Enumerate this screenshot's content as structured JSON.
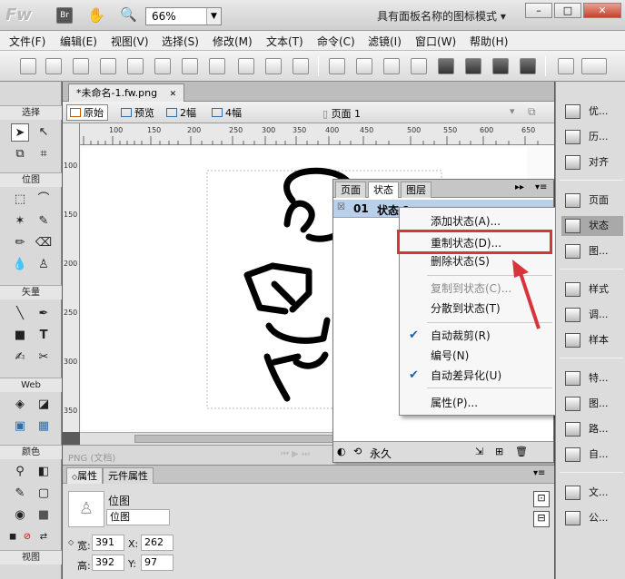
{
  "app": {
    "logo": "Fw",
    "zoom": "66%",
    "workspace_mode": "具有面板名称的图标模式",
    "window_buttons": [
      "–",
      "□",
      "✕"
    ]
  },
  "menu": [
    "文件(F)",
    "编辑(E)",
    "视图(V)",
    "选择(S)",
    "修改(M)",
    "文本(T)",
    "命令(C)",
    "滤镜(I)",
    "窗口(W)",
    "帮助(H)"
  ],
  "tools_panel": {
    "sections": [
      "选择",
      "位图",
      "矢量",
      "Web",
      "颜色",
      "视图"
    ]
  },
  "document": {
    "tab": "*未命名-1.fw.png",
    "close": "✕",
    "views": [
      "原始",
      "预览",
      "2幅",
      "4幅"
    ],
    "page_label": "页面 1",
    "ruler_ticks": [
      "100",
      "150",
      "200",
      "250",
      "300",
      "350",
      "400",
      "450",
      "500",
      "550",
      "600",
      "650"
    ],
    "ruler_v_ticks": [
      "100",
      "150",
      "200",
      "250",
      "300",
      "350"
    ],
    "status": "PNG (文档)"
  },
  "states_panel": {
    "tabs": [
      "页面",
      "状态",
      "图层"
    ],
    "row_number": "01",
    "row_name": "状态 1",
    "footer_label": "永久",
    "accent_color": "#b9d0ea"
  },
  "context_menu": {
    "items": [
      {
        "label": "添加状态(A)...",
        "enabled": true,
        "checked": false
      },
      {
        "label": "重制状态(D)...",
        "enabled": true,
        "checked": false
      },
      {
        "label": "删除状态(S)",
        "enabled": true,
        "checked": false
      },
      {
        "label": "复制到状态(C)...",
        "enabled": false,
        "checked": false
      },
      {
        "label": "分散到状态(T)",
        "enabled": true,
        "checked": false
      },
      {
        "label": "自动裁剪(R)",
        "enabled": true,
        "checked": true
      },
      {
        "label": "编号(N)",
        "enabled": true,
        "checked": false
      },
      {
        "label": "自动差异化(U)",
        "enabled": true,
        "checked": true
      },
      {
        "label": "属性(P)...",
        "enabled": true,
        "checked": false
      }
    ],
    "highlight_color": "#d8343c"
  },
  "properties": {
    "tabs": [
      "属性",
      "元件属性"
    ],
    "object_type": "位图",
    "name_value": "位图",
    "width_label": "宽:",
    "width": "391",
    "height_label": "高:",
    "height": "392",
    "x_label": "X:",
    "x": "262",
    "y_label": "Y:",
    "y": "97"
  },
  "right_panel": {
    "items": [
      "优...",
      "历...",
      "对齐",
      "页面",
      "状态",
      "图...",
      "样式",
      "调...",
      "样本",
      "特...",
      "图...",
      "路...",
      "自...",
      "文...",
      "公..."
    ]
  }
}
